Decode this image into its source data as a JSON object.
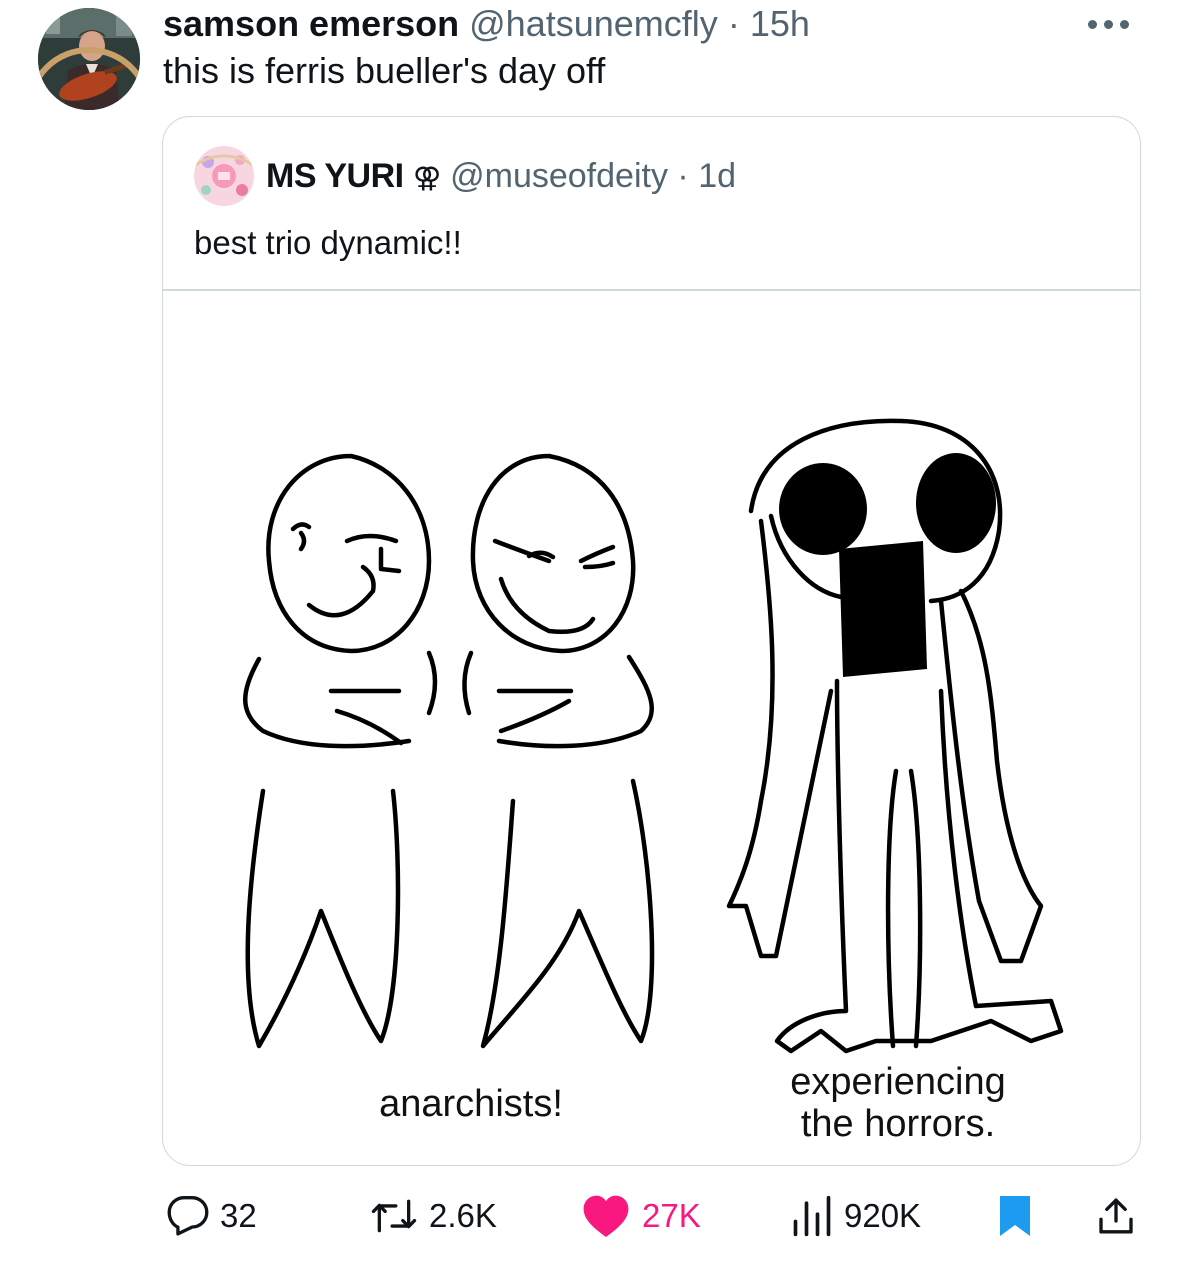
{
  "tweet": {
    "author_name": "samson emerson",
    "handle": "@hatsunemcfly",
    "time": "15h",
    "separator": "·",
    "text": "this is ferris bueller's day off",
    "avatar_icon": "profile-photo-man-with-guitar"
  },
  "quoted": {
    "author_name": "MS YURI",
    "symbol": "⚢",
    "handle": "@museofdeity",
    "time": "1d",
    "separator": "·",
    "text": "best trio dynamic!!",
    "avatar_icon": "pink-cartoon-avatar",
    "image": {
      "caption_left": "anarchists!",
      "caption_right_line1": "experiencing",
      "caption_right_line2": "the horrors."
    }
  },
  "actions": {
    "replies": "32",
    "retweets": "2.6K",
    "likes": "27K",
    "views": "920K"
  },
  "colors": {
    "text": "#0f1419",
    "muted": "#536471",
    "like": "#f91880",
    "bookmark": "#1d9bf0",
    "border": "#cfd9de"
  }
}
